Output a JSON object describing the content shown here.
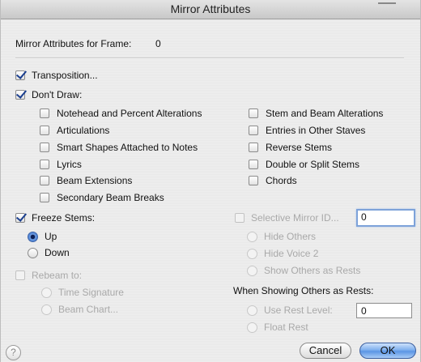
{
  "window": {
    "title": "Mirror Attributes"
  },
  "header": {
    "frame_label": "Mirror Attributes for Frame:",
    "frame_value": "0"
  },
  "transposition": {
    "label": "Transposition...",
    "checked": true
  },
  "dont_draw": {
    "label": "Don't Draw:",
    "checked": true,
    "left": [
      {
        "label": "Notehead and Percent Alterations",
        "checked": false
      },
      {
        "label": "Articulations",
        "checked": false
      },
      {
        "label": "Smart Shapes Attached to Notes",
        "checked": false
      },
      {
        "label": "Lyrics",
        "checked": false
      },
      {
        "label": "Beam Extensions",
        "checked": false
      },
      {
        "label": "Secondary Beam Breaks",
        "checked": false
      }
    ],
    "right": [
      {
        "label": "Stem and Beam Alterations",
        "checked": false
      },
      {
        "label": "Entries in Other Staves",
        "checked": false
      },
      {
        "label": "Reverse Stems",
        "checked": false
      },
      {
        "label": "Double or Split Stems",
        "checked": false
      },
      {
        "label": "Chords",
        "checked": false
      }
    ]
  },
  "freeze_stems": {
    "label": "Freeze Stems:",
    "checked": true,
    "up": "Up",
    "down": "Down",
    "selected": "Up"
  },
  "selective_mirror": {
    "label": "Selective Mirror ID...",
    "value": "0",
    "hide_others": "Hide Others",
    "hide_voice2": "Hide Voice 2",
    "show_as_rests": "Show Others as Rests"
  },
  "rebeam": {
    "label": "Rebeam to:",
    "time_signature": "Time Signature",
    "beam_chart": "Beam Chart..."
  },
  "rests": {
    "heading": "When Showing Others as Rests:",
    "use_rest_level": "Use Rest Level:",
    "rest_level_value": "0",
    "float_rest": "Float Rest"
  },
  "buttons": {
    "help": "?",
    "cancel": "Cancel",
    "ok": "OK"
  }
}
